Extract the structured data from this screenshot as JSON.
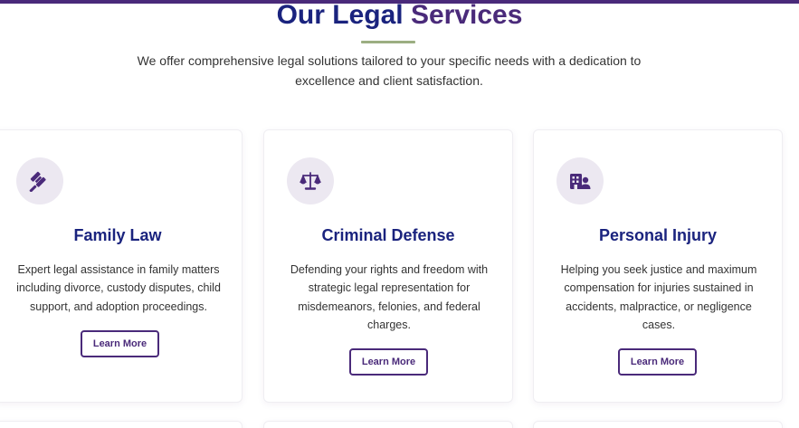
{
  "header": {
    "title_part1": "Our Legal ",
    "title_part2": "Services",
    "subtitle": "We offer comprehensive legal solutions tailored to your specific needs with a dedication to excellence and client satisfaction."
  },
  "colors": {
    "primary_navy": "#1a237e",
    "accent_purple": "#4a2a7a",
    "underline_green": "#9cae82",
    "icon_bg": "#ece8f1"
  },
  "services": [
    {
      "icon": "gavel-icon",
      "title": "Family Law",
      "description": "Expert legal assistance in family matters including divorce, custody disputes, child support, and adoption proceedings.",
      "button_label": "Learn More"
    },
    {
      "icon": "scales-icon",
      "title": "Criminal Defense",
      "description": "Defending your rights and freedom with strategic legal representation for misdemeanors, felonies, and federal charges.",
      "button_label": "Learn More"
    },
    {
      "icon": "hospital-user-icon",
      "title": "Personal Injury",
      "description": "Helping you seek justice and maximum compensation for injuries sustained in accidents, malpractice, or negligence cases.",
      "button_label": "Learn More"
    }
  ]
}
